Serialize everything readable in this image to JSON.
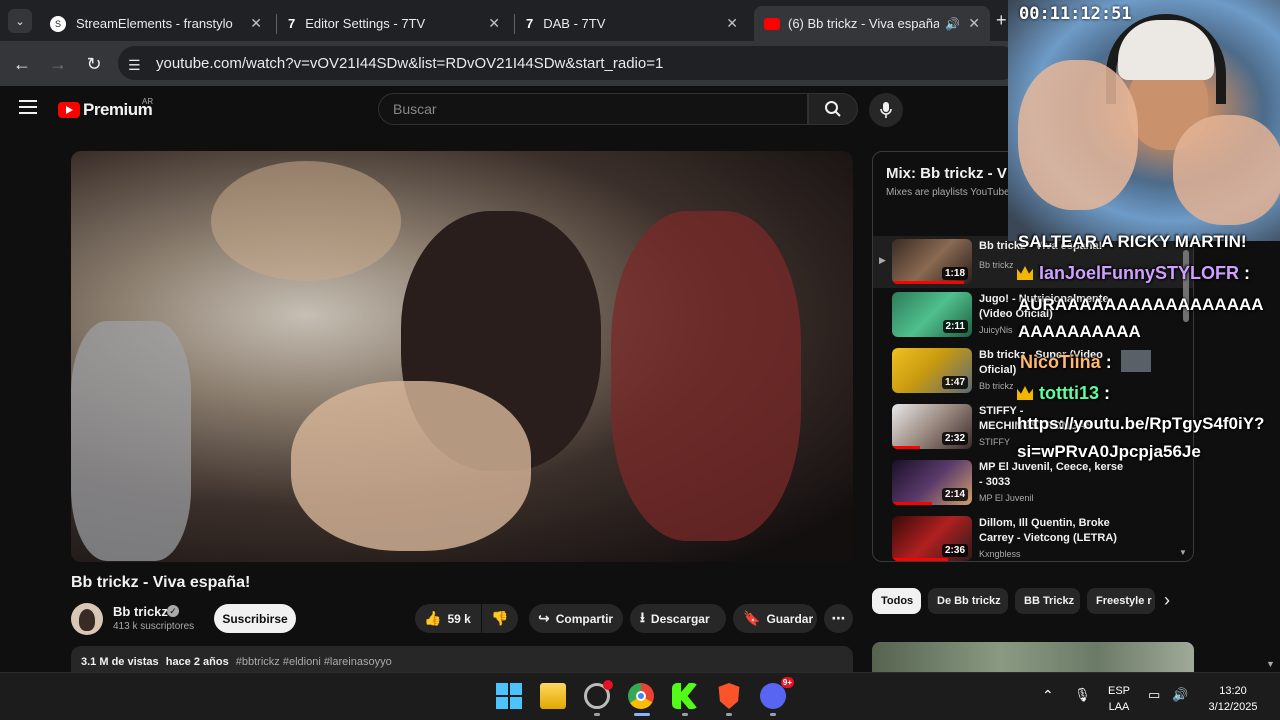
{
  "browser": {
    "tabs": [
      {
        "title": "StreamElements - franstylo",
        "icon": "streamelements-icon"
      },
      {
        "title": "Editor Settings - 7TV",
        "icon": "7tv-icon"
      },
      {
        "title": "DAB - 7TV",
        "icon": "7tv-icon"
      },
      {
        "title": "(6) Bb trickz - Viva españa!",
        "icon": "youtube-icon",
        "active": true
      }
    ],
    "url": "youtube.com/watch?v=vOV21I44SDw&list=RDvOV21I44SDw&start_radio=1"
  },
  "youtube": {
    "logo_text": "Premium",
    "country": "AR",
    "search_placeholder": "Buscar",
    "video": {
      "title": "Bb trickz - Viva españa!",
      "channel": "Bb trickz",
      "subscribers": "413 k suscriptores",
      "subscribe_label": "Suscribirse",
      "likes": "59 k",
      "share_label": "Compartir",
      "download_label": "Descargar",
      "save_label": "Guardar",
      "views": "3.1 M de vistas",
      "age": "hace 2 años",
      "hashtags": "#bbtrickz #eldioni #lareinasoyyo"
    },
    "playlist": {
      "title": "Mix: Bb trickz - V",
      "subtitle": "Mixes are playlists YouTube m",
      "items": [
        {
          "title": "Bb trickz - Viva españa!",
          "channel": "Bb trickz",
          "duration": "1:18",
          "progress": 0.9,
          "active": true
        },
        {
          "title": "Jugo! - Nutricionalmente (Video Oficial)",
          "channel": "JuicyNis",
          "duration": "2:11",
          "progress": 0
        },
        {
          "title": "Bb trickz - Super (Video Oficial)",
          "channel": "Bb trickz",
          "duration": "1:47",
          "progress": 0
        },
        {
          "title": "STIFFY - MECHINGSTRONGAS (Video Oficial)",
          "channel": "STIFFY",
          "duration": "2:32",
          "progress": 0.35
        },
        {
          "title": "MP El Juvenil, Ceece, kerse - 3033",
          "channel": "MP El Juvenil",
          "duration": "2:14",
          "progress": 0.5
        },
        {
          "title": "Dillom, Ill Quentin, Broke Carrey - Vietcong (LETRA)",
          "channel": "Kxngbless",
          "duration": "2:36",
          "progress": 0.7
        }
      ]
    },
    "chips": [
      "Todos",
      "De Bb trickz",
      "BB Trickz",
      "Freestyle r"
    ]
  },
  "stream_overlay": {
    "timer": "00:11:12:51",
    "chat": [
      {
        "user": "",
        "message": "SALTEAR A RICKY MARTIN!"
      },
      {
        "user": "IanJoelFunnySTYLOFR",
        "message": "AURAAAAAAAAAAAAAAAAAAAAAAAAAAA",
        "user_color": "#cfa0ff"
      },
      {
        "user": "NicoTiina",
        "message": "",
        "user_color": "#ffb870"
      },
      {
        "user": "tottti13",
        "message": "https://youtu.be/RpTgyS4f0iY?si=wPRvA0Jpcpja56Je",
        "user_color": "#5cff9d"
      }
    ]
  },
  "taskbar": {
    "language": "ESP",
    "layout": "LAA",
    "time": "13:20",
    "date": "3/12/2025",
    "discord_badge": "9+"
  }
}
